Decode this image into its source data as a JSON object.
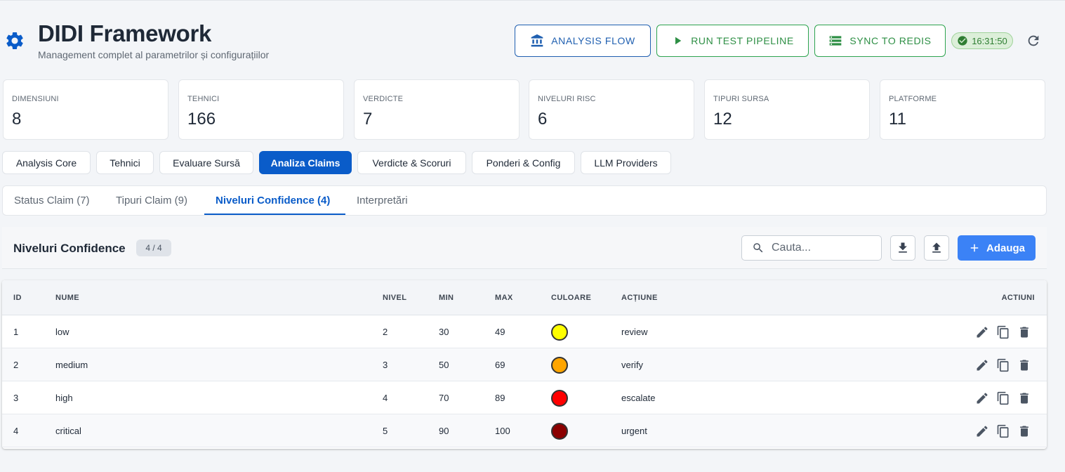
{
  "header": {
    "title": "DIDI Framework",
    "subtitle": "Management complet al parametrilor și configurațiilor",
    "buttons": {
      "analysis_flow": "ANALYSIS FLOW",
      "run_test_pipeline": "RUN TEST PIPELINE",
      "sync_to_redis": "SYNC TO REDIS"
    },
    "time": "16:31:50"
  },
  "stats": [
    {
      "label": "DIMENSIUNI",
      "value": "8"
    },
    {
      "label": "TEHNICI",
      "value": "166"
    },
    {
      "label": "VERDICTE",
      "value": "7"
    },
    {
      "label": "NIVELURI RISC",
      "value": "6"
    },
    {
      "label": "TIPURI SURSA",
      "value": "12"
    },
    {
      "label": "PLATFORME",
      "value": "11"
    }
  ],
  "main_tabs": [
    {
      "label": "Analysis Core"
    },
    {
      "label": "Tehnici"
    },
    {
      "label": "Evaluare Sursă"
    },
    {
      "label": "Analiza Claims",
      "active": true
    },
    {
      "label": "Verdicte & Scoruri"
    },
    {
      "label": "Ponderi & Config"
    },
    {
      "label": "LLM Providers"
    }
  ],
  "sub_tabs": [
    {
      "label": "Status Claim (7)"
    },
    {
      "label": "Tipuri Claim (9)"
    },
    {
      "label": "Niveluri Confidence (4)",
      "active": true
    },
    {
      "label": "Interpretări"
    }
  ],
  "panel": {
    "title": "Niveluri Confidence",
    "count": "4 / 4",
    "search_placeholder": "Cauta...",
    "add_label": "Adauga"
  },
  "table": {
    "columns": {
      "id": "ID",
      "nume": "NUME",
      "nivel": "NIVEL",
      "min": "MIN",
      "max": "MAX",
      "culoare": "CULOARE",
      "actiune": "ACȚIUNE",
      "actiuni": "ACTIUNI"
    },
    "rows": [
      {
        "id": "1",
        "nume": "low",
        "nivel": "2",
        "min": "30",
        "max": "49",
        "color": "#ffff00",
        "actiune": "review"
      },
      {
        "id": "2",
        "nume": "medium",
        "nivel": "3",
        "min": "50",
        "max": "69",
        "color": "#ffa500",
        "actiune": "verify"
      },
      {
        "id": "3",
        "nume": "high",
        "nivel": "4",
        "min": "70",
        "max": "89",
        "color": "#ff0000",
        "actiune": "escalate"
      },
      {
        "id": "4",
        "nume": "critical",
        "nivel": "5",
        "min": "90",
        "max": "100",
        "color": "#8b0000",
        "actiune": "urgent"
      }
    ]
  },
  "icons": {
    "logo": "gear-icon",
    "analysis_flow": "bank-icon",
    "run_test_pipeline": "play-icon",
    "sync_to_redis": "server-stack-icon",
    "time": "check-circle-icon",
    "refresh": "refresh-icon",
    "search": "search-icon",
    "export": "download-icon",
    "import": "upload-icon",
    "add": "plus-icon",
    "row_actions": [
      "edit-icon",
      "copy-icon",
      "delete-icon"
    ]
  },
  "colors": {
    "primary": "#0a5cc9",
    "accent_blue": "#3b82f6",
    "success": "#2ea44f",
    "analysis_flow": "#1f5fb0"
  }
}
